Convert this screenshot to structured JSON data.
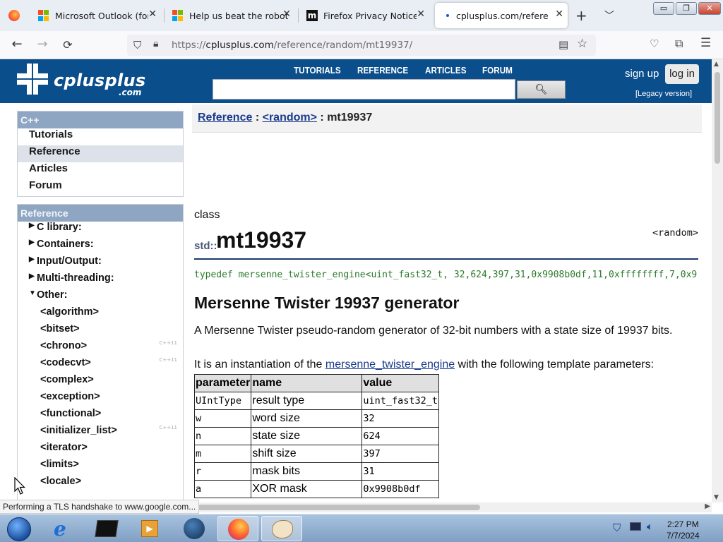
{
  "browser": {
    "tabs": [
      {
        "title": "Microsoft Outlook (form",
        "favicon": "microsoft-logo"
      },
      {
        "title": "Help us beat the robots",
        "favicon": "microsoft-logo"
      },
      {
        "title": "Firefox Privacy Notice —",
        "favicon": "m-logo"
      },
      {
        "title": "cplusplus.com/reference",
        "favicon": "loading-dot"
      }
    ],
    "url": {
      "scheme": "https://",
      "domain": "cplusplus.com",
      "path": "/reference/random/mt19937/"
    }
  },
  "site": {
    "logo_word": "cplusplus",
    "logo_com": ".com",
    "nav": [
      "TUTORIALS",
      "REFERENCE",
      "ARTICLES",
      "FORUM"
    ],
    "sign_up": "sign up",
    "log_in": "log in",
    "legacy": "[Legacy version]"
  },
  "sidebar": {
    "cpp_header": "C++",
    "cpp_items": [
      {
        "label": "Tutorials",
        "selected": false
      },
      {
        "label": "Reference",
        "selected": true
      },
      {
        "label": "Articles",
        "selected": false
      },
      {
        "label": "Forum",
        "selected": false
      }
    ],
    "ref_header": "Reference",
    "ref_items": [
      {
        "label": "C library:",
        "state": "collapsed",
        "badge": ""
      },
      {
        "label": "Containers:",
        "state": "collapsed",
        "badge": ""
      },
      {
        "label": "Input/Output:",
        "state": "collapsed",
        "badge": ""
      },
      {
        "label": "Multi-threading:",
        "state": "collapsed",
        "badge": ""
      },
      {
        "label": "Other:",
        "state": "expanded",
        "badge": ""
      },
      {
        "label": "<algorithm>",
        "state": "child",
        "badge": ""
      },
      {
        "label": "<bitset>",
        "state": "child",
        "badge": ""
      },
      {
        "label": "<chrono>",
        "state": "child",
        "badge": "C++11"
      },
      {
        "label": "<codecvt>",
        "state": "child",
        "badge": "C++11"
      },
      {
        "label": "<complex>",
        "state": "child",
        "badge": ""
      },
      {
        "label": "<exception>",
        "state": "child",
        "badge": ""
      },
      {
        "label": "<functional>",
        "state": "child",
        "badge": ""
      },
      {
        "label": "<initializer_list>",
        "state": "child",
        "badge": "C++11"
      },
      {
        "label": "<iterator>",
        "state": "child",
        "badge": ""
      },
      {
        "label": "<limits>",
        "state": "child",
        "badge": ""
      },
      {
        "label": "<locale>",
        "state": "child",
        "badge": ""
      }
    ]
  },
  "content": {
    "breadcrumb": {
      "reference": "Reference",
      "random": "<random>",
      "current": "mt19937",
      "sep": ":"
    },
    "kind": "class",
    "namespace": "std::",
    "name": "mt19937",
    "header": "<random>",
    "typedef": "typedef mersenne_twister_engine<uint_fast32_t,  32,624,397,31,0x9908b0df,11,0xffffffff,7,0x9",
    "heading": "Mersenne Twister 19937 generator",
    "description": "A Mersenne Twister pseudo-random generator of 32-bit numbers with a state size of 19937 bits.",
    "inst_before": "It is an instantiation of the ",
    "inst_link": "mersenne_twister_engine",
    "inst_after": " with the following template parameters:",
    "table": {
      "headers": [
        "parameter",
        "name",
        "value"
      ],
      "rows": [
        [
          "UIntType",
          "result type",
          "uint_fast32_t"
        ],
        [
          "w",
          "word size",
          "32"
        ],
        [
          "n",
          "state size",
          "624"
        ],
        [
          "m",
          "shift size",
          "397"
        ],
        [
          "r",
          "mask bits",
          "31"
        ],
        [
          "a",
          "XOR mask",
          "0x9908b0df"
        ]
      ]
    }
  },
  "status_text": "Performing a TLS handshake to www.google.com...",
  "taskbar": {
    "time": "2:27 PM",
    "date": "7/7/2024"
  },
  "colors": {
    "site_header": "#0a4e8c",
    "typedef_green": "#2b7a2b",
    "link": "#1a3a8c"
  }
}
